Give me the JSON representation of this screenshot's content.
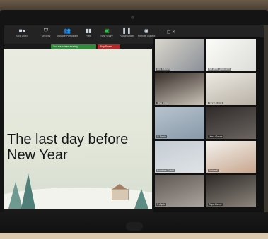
{
  "toolbar": {
    "buttons": [
      {
        "label": "Stop Video",
        "icon": "video-camera-icon"
      },
      {
        "label": "Security",
        "icon": "shield-icon"
      },
      {
        "label": "Manage Participants",
        "icon": "participants-icon"
      },
      {
        "label": "Polls",
        "icon": "bar-chart-icon"
      },
      {
        "label": "New Share",
        "icon": "share-screen-icon"
      },
      {
        "label": "Pause Share",
        "icon": "pause-icon"
      },
      {
        "label": "Remote Control",
        "icon": "mouse-icon"
      }
    ],
    "sharing_chip": "You are screen sharing",
    "stop_share_label": "Stop Share"
  },
  "slide": {
    "title_line1": "The last day before",
    "title_line2": "New Year"
  },
  "gallery": {
    "tiles": [
      {
        "name": "Ava Kaplan"
      },
      {
        "name": "Bui Dinh Quoc Anh"
      },
      {
        "name": "Tavli Alga"
      },
      {
        "name": "Handan Eris"
      },
      {
        "name": "G Sahin"
      },
      {
        "name": "Umut Gokce"
      },
      {
        "name": "Kocabas Cahid"
      },
      {
        "name": "Emine K"
      },
      {
        "name": "S Aydin"
      },
      {
        "name": "Oguz Demir"
      }
    ]
  },
  "colors": {
    "toolbar_bg": "#232323",
    "share_green": "#2f8a3a",
    "stop_red": "#b92626",
    "slide_bg": "#e9ebe1"
  }
}
